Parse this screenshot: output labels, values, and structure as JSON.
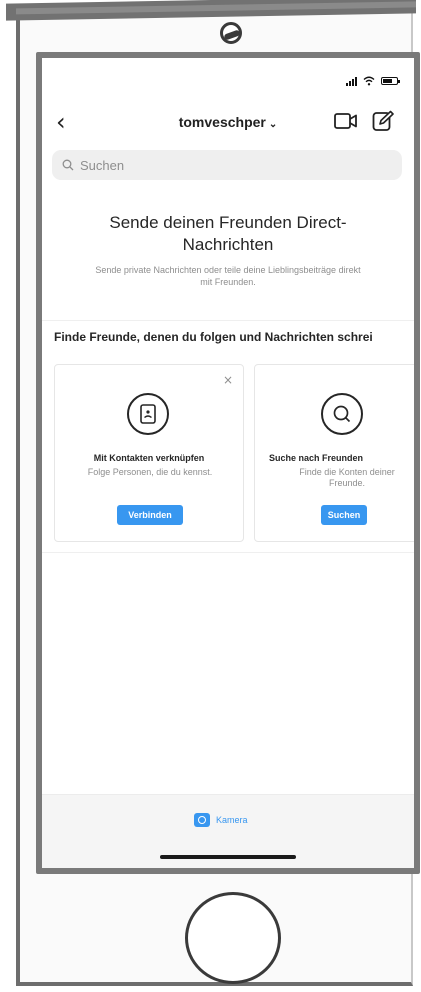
{
  "nav": {
    "back_icon": "chevron-left-icon",
    "account_name": "tomveschper",
    "account_chevron": "⌄",
    "video_icon": "video-camera-icon",
    "compose_icon": "compose-icon"
  },
  "search": {
    "placeholder": "Suchen"
  },
  "empty_state": {
    "title": "Sende deinen Freunden Direct-Nachrichten",
    "subtitle": "Sende private Nachrichten oder teile deine Lieblingsbeiträge direkt mit Freunden."
  },
  "find_friends": {
    "header": "Finde Freunde, denen du folgen und Nachrichten schrei",
    "cards": [
      {
        "icon": "contacts-icon",
        "title": "Mit Kontakten verknüpfen",
        "description": "Folge Personen, die du kennst.",
        "button": "Verbinden",
        "close": "×"
      },
      {
        "icon": "search-icon",
        "title": "Suche nach Freunden",
        "description": "Finde die Konten deiner Freunde.",
        "button": "Suchen"
      }
    ]
  },
  "bottom_bar": {
    "camera_label": "Kamera",
    "camera_icon": "camera-icon"
  },
  "colors": {
    "accent": "#3897f0",
    "text_primary": "#262626",
    "text_secondary": "#8e8e8e",
    "search_bg": "#efefef"
  }
}
